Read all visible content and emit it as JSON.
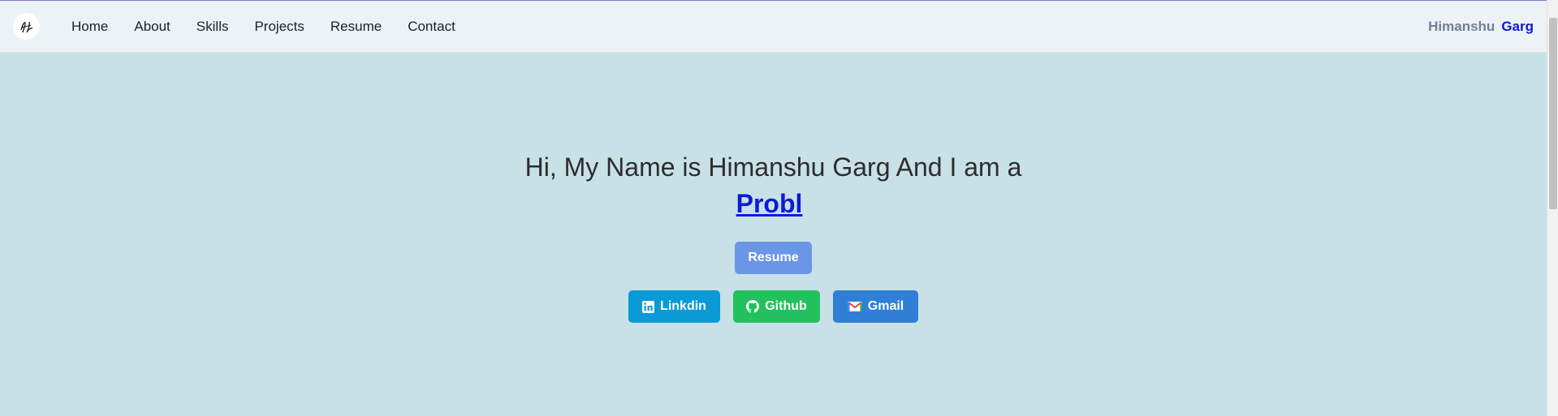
{
  "nav": {
    "logo_icon": "signature-logo-icon",
    "links": [
      "Home",
      "About",
      "Skills",
      "Projects",
      "Resume",
      "Contact"
    ],
    "brand_first": "Himanshu",
    "brand_last": "Garg"
  },
  "hero": {
    "title": "Hi, My Name is Himanshu Garg And I am a",
    "typed_text": "Probl",
    "resume_label": "Resume",
    "social": {
      "linkedin": "Linkdin",
      "github": "Github",
      "gmail": "Gmail"
    }
  },
  "colors": {
    "background": "#c8e1e6",
    "navbar": "#edf2f7",
    "brand_accent": "#0a19d6",
    "resume_button": "#6b96e8",
    "linkedin": "#0a9ad6",
    "github": "#22c15e",
    "gmail": "#2f7fd6"
  }
}
